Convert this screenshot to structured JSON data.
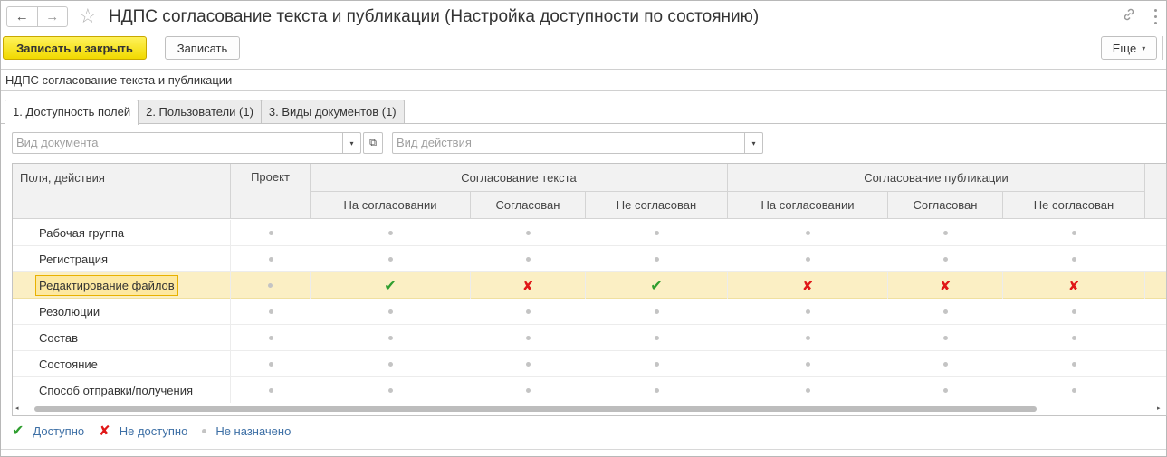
{
  "window": {
    "title": "НДПС согласование текста и публикации (Настройка доступности по состоянию)",
    "back_icon": "←",
    "forward_icon": "→",
    "star_icon": "☆",
    "link_icon": "🔗"
  },
  "toolbar": {
    "save_close_label": "Записать и закрыть",
    "save_label": "Записать",
    "more_label": "Еще",
    "more_caret": "▾"
  },
  "name_field": {
    "value": "НДПС согласование текста и публикации"
  },
  "tabs": [
    {
      "label": "1. Доступность полей",
      "active": true
    },
    {
      "label": "2. Пользователи (1)",
      "active": false
    },
    {
      "label": "3. Виды документов (1)",
      "active": false
    }
  ],
  "filters": {
    "doc_type_placeholder": "Вид документа",
    "action_type_placeholder": "Вид действия",
    "dropdown_caret": "▾",
    "open_icon": "⧉"
  },
  "table": {
    "col_fields": "Поля, действия",
    "col_project": "Проект",
    "group_text": "Согласование текста",
    "group_pub": "Согласование публикации",
    "sub_on_approval": "На согласовании",
    "sub_approved": "Согласован",
    "sub_not_approved": "Не согласован",
    "rows": [
      {
        "label": "Рабочая группа",
        "values": [
          "dot",
          "dot",
          "dot",
          "dot",
          "dot",
          "dot",
          "dot"
        ]
      },
      {
        "label": "Регистрация",
        "values": [
          "dot",
          "dot",
          "dot",
          "dot",
          "dot",
          "dot",
          "dot"
        ]
      },
      {
        "label": "Редактирование файлов",
        "values": [
          "dot",
          "check",
          "cross",
          "check",
          "cross",
          "cross",
          "cross"
        ],
        "selected": true
      },
      {
        "label": "Резолюции",
        "values": [
          "dot",
          "dot",
          "dot",
          "dot",
          "dot",
          "dot",
          "dot"
        ]
      },
      {
        "label": "Состав",
        "values": [
          "dot",
          "dot",
          "dot",
          "dot",
          "dot",
          "dot",
          "dot"
        ]
      },
      {
        "label": "Состояние",
        "values": [
          "dot",
          "dot",
          "dot",
          "dot",
          "dot",
          "dot",
          "dot"
        ]
      },
      {
        "label": "Способ отправки/получения",
        "values": [
          "dot",
          "dot",
          "dot",
          "dot",
          "dot",
          "dot",
          "dot"
        ]
      }
    ],
    "scroll_left": "◂",
    "scroll_right": "▸"
  },
  "symbols": {
    "check": "✔",
    "cross": "✘"
  },
  "legend": {
    "available": "Доступно",
    "not_available": "Не доступно",
    "not_assigned": "Не назначено"
  },
  "colors": {
    "check": "#2f9e2f",
    "cross": "#e01818",
    "selected_row": "#fbefc4",
    "primary_button": "#f1d900",
    "legend_text": "#3d6fa5"
  }
}
